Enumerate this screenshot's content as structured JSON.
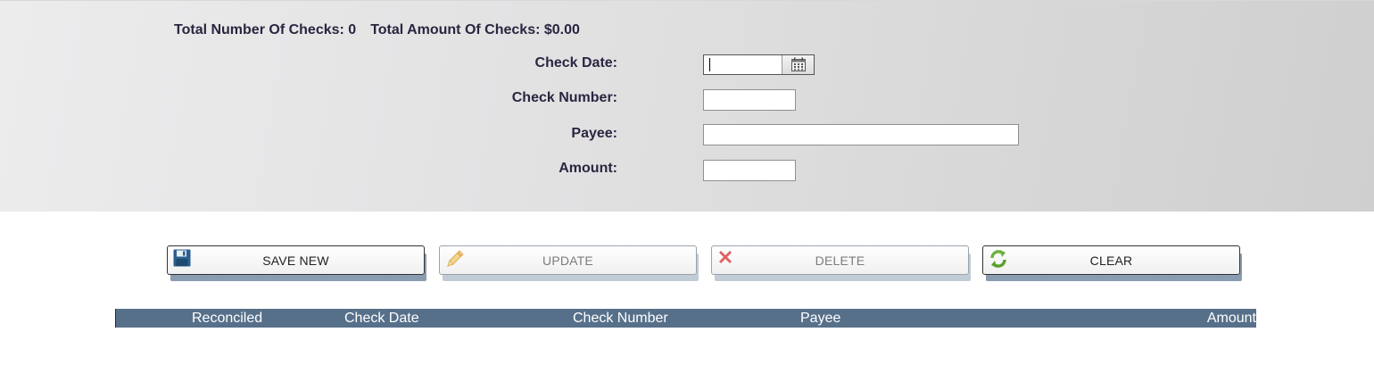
{
  "summary": {
    "total_checks_label": "Total Number Of Checks: 0",
    "total_amount_label": "Total Amount Of Checks: $0.00"
  },
  "form": {
    "check_date": {
      "label": "Check Date:",
      "value": ""
    },
    "check_number": {
      "label": "Check Number:",
      "value": ""
    },
    "payee": {
      "label": "Payee:",
      "value": ""
    },
    "amount": {
      "label": "Amount:",
      "value": ""
    }
  },
  "toolbar": {
    "save_label": "SAVE NEW",
    "update_label": "UPDATE",
    "delete_label": "DELETE",
    "clear_label": "CLEAR"
  },
  "icons": {
    "calendar": "calendar-icon",
    "save": "save-disk-icon",
    "update": "pencil-icon",
    "delete": "x-icon",
    "clear": "refresh-icon"
  },
  "grid": {
    "columns": [
      "Reconciled",
      "Check Date",
      "Check Number",
      "Payee",
      "Amount"
    ]
  },
  "colors": {
    "grid_header": "#57708a",
    "label_text": "#2b2540",
    "save_icon": "#2a5f8f",
    "delete_icon": "#e06060",
    "clear_icon": "#6cb23a"
  }
}
